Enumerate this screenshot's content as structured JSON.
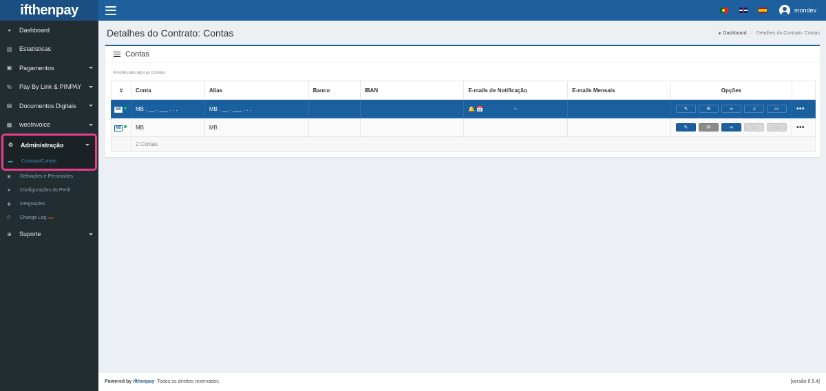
{
  "brand": {
    "logo_text": "ifthenpay"
  },
  "topbar": {
    "user_name": "mondev",
    "languages": [
      "pt",
      "en",
      "es"
    ]
  },
  "sidebar": {
    "items": [
      {
        "label": "Dashboard",
        "icon": "dashboard-icon",
        "glyph": "◕",
        "caret": false
      },
      {
        "label": "Estatísticas",
        "icon": "bar-chart-icon",
        "glyph": "▥",
        "caret": false
      },
      {
        "label": "Pagamentos",
        "icon": "payments-icon",
        "glyph": "▣",
        "caret": true
      },
      {
        "label": "Pay By Link & PINPAY",
        "icon": "link-icon",
        "glyph": "%",
        "caret": true
      },
      {
        "label": "Documentos Digitais",
        "icon": "document-icon",
        "glyph": "▤",
        "caret": true
      },
      {
        "label": "weoInvoice",
        "icon": "invoice-icon",
        "glyph": "▦",
        "caret": true
      }
    ],
    "active_group": {
      "label": "Administração",
      "icon": "cogs-icon",
      "glyph": "⚙"
    },
    "sub_items": [
      {
        "label": "Contrato/Contas",
        "glyph": "▬",
        "active": true
      },
      {
        "label": "Definições e Permissões",
        "glyph": "✱",
        "active": false
      },
      {
        "label": "Configurações do Perfil",
        "glyph": "●",
        "active": false
      },
      {
        "label": "Integrações",
        "glyph": "✚",
        "active": false
      }
    ],
    "changelog": {
      "label": "Change Log",
      "badge": "NEW",
      "glyph": "P"
    },
    "support": {
      "label": "Suporte",
      "glyph": "⊕"
    }
  },
  "page": {
    "title": "Detalhes do Contrato: Contas",
    "breadcrumb_home": "Dashboard",
    "breadcrumb_current": "Detalhes do Contrato: Contas"
  },
  "box": {
    "title": "Contas",
    "drag_hint": "Arraste para aqui as colunas"
  },
  "table": {
    "headers": {
      "num": "#",
      "conta": "Conta",
      "alias": "Alias",
      "banco": "Banco",
      "iban": "IBAN",
      "emails_notif": "E-mails de Notificação",
      "emails_mensais": "E-mails Mensais",
      "opcoes": "Opções"
    },
    "rows": [
      {
        "type_label": "MB",
        "conta": "MB . __ . ___ . . .",
        "alias": "MB . __ . ___ . . .",
        "banco": "",
        "iban": "",
        "notif_icons": "🔔📅",
        "notif_extra": "~",
        "mensais": ""
      },
      {
        "type_label": "MB",
        "conta": "MB",
        "alias": "MB .",
        "banco": "",
        "iban": "",
        "notif_icons": "",
        "notif_extra": "",
        "mensais": ""
      }
    ],
    "footer_count": "2 Contas",
    "more_glyph": "•••"
  },
  "footer": {
    "powered_prefix": "Powered by",
    "powered_brand": "ifthenpay",
    "powered_suffix": " - Todos os direitos reservados.",
    "version": "[versão 8.5.4]"
  },
  "colors": {
    "accent": "#1e5f9e",
    "sidebar": "#222d32",
    "highlight": "#e83e8c"
  }
}
